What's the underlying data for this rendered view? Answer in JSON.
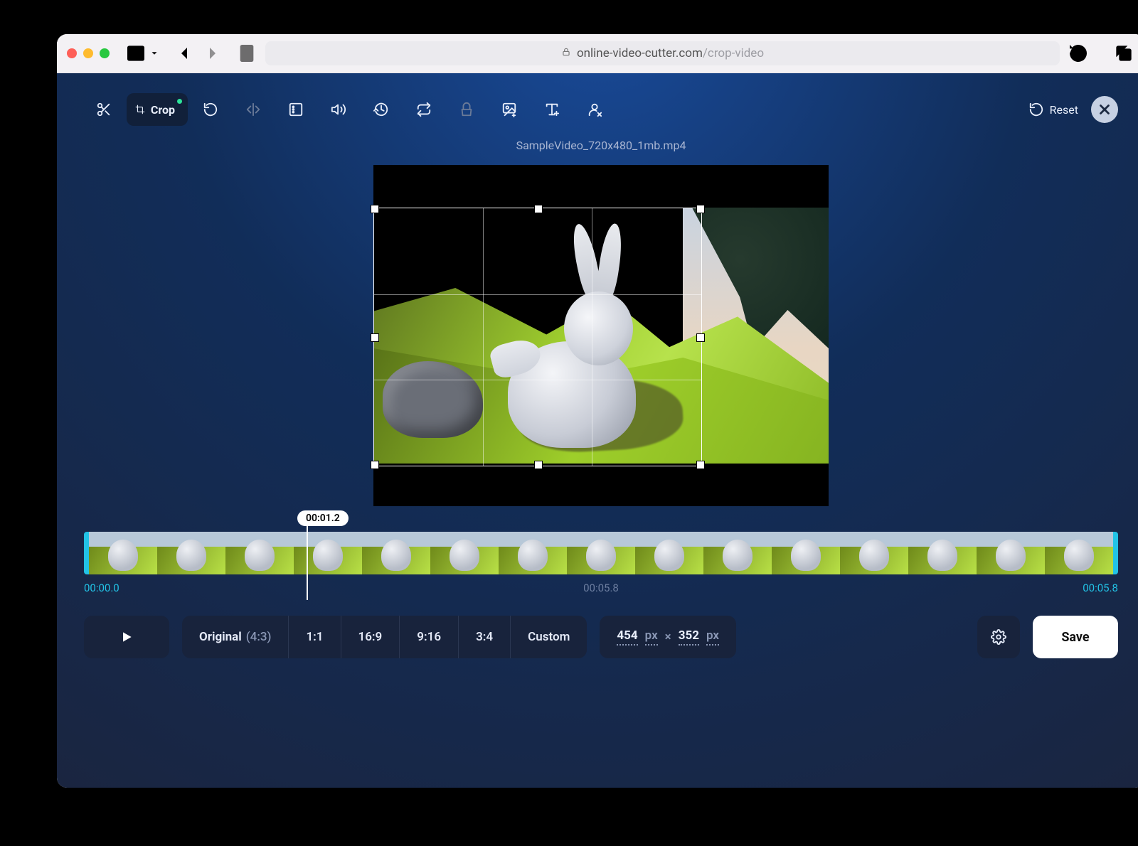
{
  "browser": {
    "url_host": "online-video-cutter.com",
    "url_path": "/crop-video"
  },
  "toolbar": {
    "crop_label": "Crop",
    "reset_label": "Reset"
  },
  "filename": "SampleVideo_720x480_1mb.mp4",
  "timeline": {
    "playhead_label": "00:01.2",
    "start_label": "00:00.0",
    "mid_label": "00:05.8",
    "end_label": "00:05.8"
  },
  "ratios": {
    "original_label": "Original",
    "original_sub": "(4:3)",
    "r11": "1:1",
    "r169": "16:9",
    "r916": "9:16",
    "r34": "3:4",
    "custom": "Custom"
  },
  "dimensions": {
    "width": "454",
    "width_unit": "px",
    "sep": "×",
    "height": "352",
    "height_unit": "px"
  },
  "bottombar": {
    "save_label": "Save"
  }
}
